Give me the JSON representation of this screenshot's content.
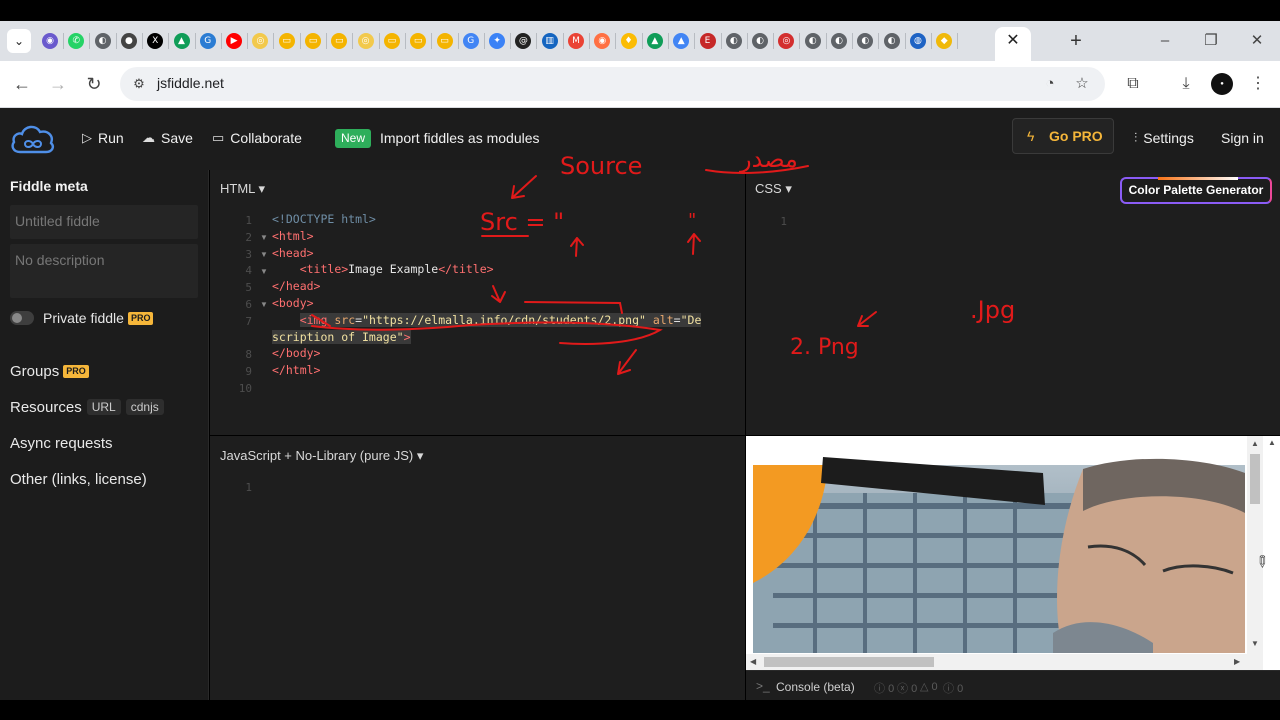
{
  "browser": {
    "url": "jsfiddle.net",
    "tab_favicons": [
      {
        "icon": "github-icon",
        "color": "#6a5acd",
        "glyph": "◉"
      },
      {
        "icon": "whatsapp-icon",
        "color": "#25d366",
        "glyph": "✆"
      },
      {
        "icon": "globe-icon",
        "color": "#5f6368",
        "glyph": "◐"
      },
      {
        "icon": "photo-icon",
        "color": "#444444",
        "glyph": "●"
      },
      {
        "icon": "x-icon",
        "color": "#000000",
        "glyph": "X"
      },
      {
        "icon": "drive-icon",
        "color": "#0f9d58",
        "glyph": "▲"
      },
      {
        "icon": "go-icon",
        "color": "#2b7cd3",
        "glyph": "G"
      },
      {
        "icon": "youtube-icon",
        "color": "#ff0000",
        "glyph": "▶"
      },
      {
        "icon": "miro-icon",
        "color": "#f2c94c",
        "glyph": "◎"
      },
      {
        "icon": "slides-icon",
        "color": "#f4b400",
        "glyph": "▭"
      },
      {
        "icon": "slides-icon",
        "color": "#f4b400",
        "glyph": "▭"
      },
      {
        "icon": "slides-icon",
        "color": "#f4b400",
        "glyph": "▭"
      },
      {
        "icon": "miro-icon",
        "color": "#f2c94c",
        "glyph": "◎"
      },
      {
        "icon": "slides-icon",
        "color": "#f4b400",
        "glyph": "▭"
      },
      {
        "icon": "slides-icon",
        "color": "#f4b400",
        "glyph": "▭"
      },
      {
        "icon": "slides-icon",
        "color": "#f4b400",
        "glyph": "▭"
      },
      {
        "icon": "google-icon",
        "color": "#4285f4",
        "glyph": "G"
      },
      {
        "icon": "compass-icon",
        "color": "#3b82f6",
        "glyph": "✦"
      },
      {
        "icon": "at-icon",
        "color": "#222222",
        "glyph": "@"
      },
      {
        "icon": "board-icon",
        "color": "#1565c0",
        "glyph": "▥"
      },
      {
        "icon": "gmail-icon",
        "color": "#ea4335",
        "glyph": "M"
      },
      {
        "icon": "chrome-icon",
        "color": "#ff7043",
        "glyph": "◉"
      },
      {
        "icon": "maps-icon",
        "color": "#fbbc04",
        "glyph": "♦"
      },
      {
        "icon": "drive-icon",
        "color": "#0f9d58",
        "glyph": "▲"
      },
      {
        "icon": "drive-icon",
        "color": "#4285f4",
        "glyph": "▲"
      },
      {
        "icon": "e-icon",
        "color": "#c62828",
        "glyph": "E"
      },
      {
        "icon": "globe-icon",
        "color": "#5f6368",
        "glyph": "◐"
      },
      {
        "icon": "globe-icon",
        "color": "#5f6368",
        "glyph": "◐"
      },
      {
        "icon": "target-icon",
        "color": "#d32f2f",
        "glyph": "◎"
      },
      {
        "icon": "globe-icon",
        "color": "#5f6368",
        "glyph": "◐"
      },
      {
        "icon": "globe-icon",
        "color": "#5f6368",
        "glyph": "◐"
      },
      {
        "icon": "globe-icon",
        "color": "#5f6368",
        "glyph": "◐"
      },
      {
        "icon": "globe-icon",
        "color": "#5f6368",
        "glyph": "◐"
      },
      {
        "icon": "edu-icon",
        "color": "#1e63c4",
        "glyph": "◍"
      },
      {
        "icon": "binance-icon",
        "color": "#f0b90b",
        "glyph": "◆"
      }
    ]
  },
  "header": {
    "run": "Run",
    "save": "Save",
    "collaborate": "Collaborate",
    "new_badge": "New",
    "import": "Import fiddles as modules",
    "go_pro": "Go PRO",
    "settings": "Settings",
    "sign_in": "Sign in"
  },
  "sidebar": {
    "title": "Fiddle meta",
    "title_placeholder": "Untitled fiddle",
    "description_placeholder": "No description",
    "private": "Private fiddle",
    "pro": "PRO",
    "groups": "Groups",
    "resources": "Resources",
    "url_chip": "URL",
    "cdnjs_chip": "cdnjs",
    "async": "Async requests",
    "other": "Other (links, license)"
  },
  "editors": {
    "html_label": "HTML ▾",
    "css_label": "CSS ▾",
    "js_label": "JavaScript + No-Library (pure JS) ▾",
    "html_line_numbers": [
      "1",
      "2",
      "3",
      "4",
      "5",
      "6",
      "7",
      "",
      "8",
      "9",
      "10"
    ],
    "css_line_numbers": [
      "1"
    ],
    "js_line_numbers": [
      "1"
    ],
    "color_palette_button": "Color Palette Generator"
  },
  "console": {
    "label": "Console (beta)",
    "counts": [
      "0",
      "0",
      "0",
      "0"
    ]
  },
  "annotations": {
    "source_label": "Source",
    "arabic_note": "مصدر",
    "src_label": "Src = \"",
    "quote": "\"",
    "png_label": "2. Png",
    "jpg_label": ".Jpg",
    "ink_color": "#e11a1a"
  }
}
